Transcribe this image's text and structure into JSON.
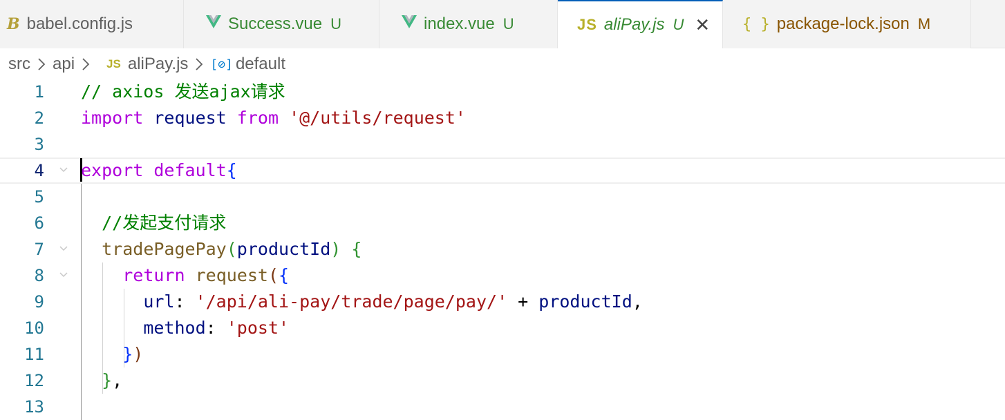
{
  "tabs": [
    {
      "icon": "B",
      "icon_name": "babel-icon",
      "name": "babel.config.js",
      "badge": ""
    },
    {
      "icon": "V",
      "icon_name": "vue-icon",
      "name": "Success.vue",
      "badge": "U"
    },
    {
      "icon": "V",
      "icon_name": "vue-icon",
      "name": "index.vue",
      "badge": "U"
    },
    {
      "icon": "JS",
      "icon_name": "javascript-icon",
      "name": "aliPay.js",
      "badge": "U",
      "active": true
    },
    {
      "icon": "{ }",
      "icon_name": "json-icon",
      "name": "package-lock.json",
      "badge": "M"
    }
  ],
  "breadcrumb": {
    "items": [
      "src",
      "api",
      "aliPay.js",
      "default"
    ],
    "file_icon": "JS",
    "symbol_icon": "[⊘]"
  },
  "editor": {
    "current_line": 4,
    "lines": [
      {
        "n": "1",
        "tokens": [
          [
            "// axios 发送ajax请求",
            "comment"
          ]
        ]
      },
      {
        "n": "2",
        "tokens": [
          [
            "import",
            "kw"
          ],
          [
            " ",
            "plain"
          ],
          [
            "request",
            "var"
          ],
          [
            " ",
            "plain"
          ],
          [
            "from",
            "kw"
          ],
          [
            " ",
            "plain"
          ],
          [
            "'@/utils/request'",
            "str"
          ]
        ]
      },
      {
        "n": "3",
        "tokens": []
      },
      {
        "n": "4",
        "tokens": [
          [
            "export",
            "kw"
          ],
          [
            " ",
            "plain"
          ],
          [
            "default",
            "kw"
          ],
          [
            "{",
            "p1"
          ]
        ]
      },
      {
        "n": "5",
        "tokens": []
      },
      {
        "n": "6",
        "tokens": [
          [
            "  //发起支付请求",
            "comment"
          ]
        ]
      },
      {
        "n": "7",
        "tokens": [
          [
            "  ",
            "plain"
          ],
          [
            "tradePagePay",
            "fn"
          ],
          [
            "(",
            "p2"
          ],
          [
            "productId",
            "var"
          ],
          [
            ")",
            "p2"
          ],
          [
            " ",
            "plain"
          ],
          [
            "{",
            "p2"
          ]
        ]
      },
      {
        "n": "8",
        "tokens": [
          [
            "    ",
            "plain"
          ],
          [
            "return",
            "kw"
          ],
          [
            " ",
            "plain"
          ],
          [
            "request",
            "fn"
          ],
          [
            "(",
            "p3"
          ],
          [
            "{",
            "p1"
          ]
        ]
      },
      {
        "n": "9",
        "tokens": [
          [
            "      ",
            "plain"
          ],
          [
            "url",
            "var"
          ],
          [
            ": ",
            "plain"
          ],
          [
            "'/api/ali-pay/trade/page/pay/'",
            "str"
          ],
          [
            " + ",
            "plain"
          ],
          [
            "productId",
            "var"
          ],
          [
            ",",
            "plain"
          ]
        ]
      },
      {
        "n": "10",
        "tokens": [
          [
            "      ",
            "plain"
          ],
          [
            "method",
            "var"
          ],
          [
            ": ",
            "plain"
          ],
          [
            "'post'",
            "str"
          ]
        ]
      },
      {
        "n": "11",
        "tokens": [
          [
            "    ",
            "plain"
          ],
          [
            "}",
            "p1"
          ],
          [
            ")",
            "p3"
          ]
        ]
      },
      {
        "n": "12",
        "tokens": [
          [
            "  ",
            "plain"
          ],
          [
            "}",
            "p2"
          ],
          [
            ",",
            "plain"
          ]
        ]
      },
      {
        "n": "13",
        "tokens": []
      }
    ]
  }
}
